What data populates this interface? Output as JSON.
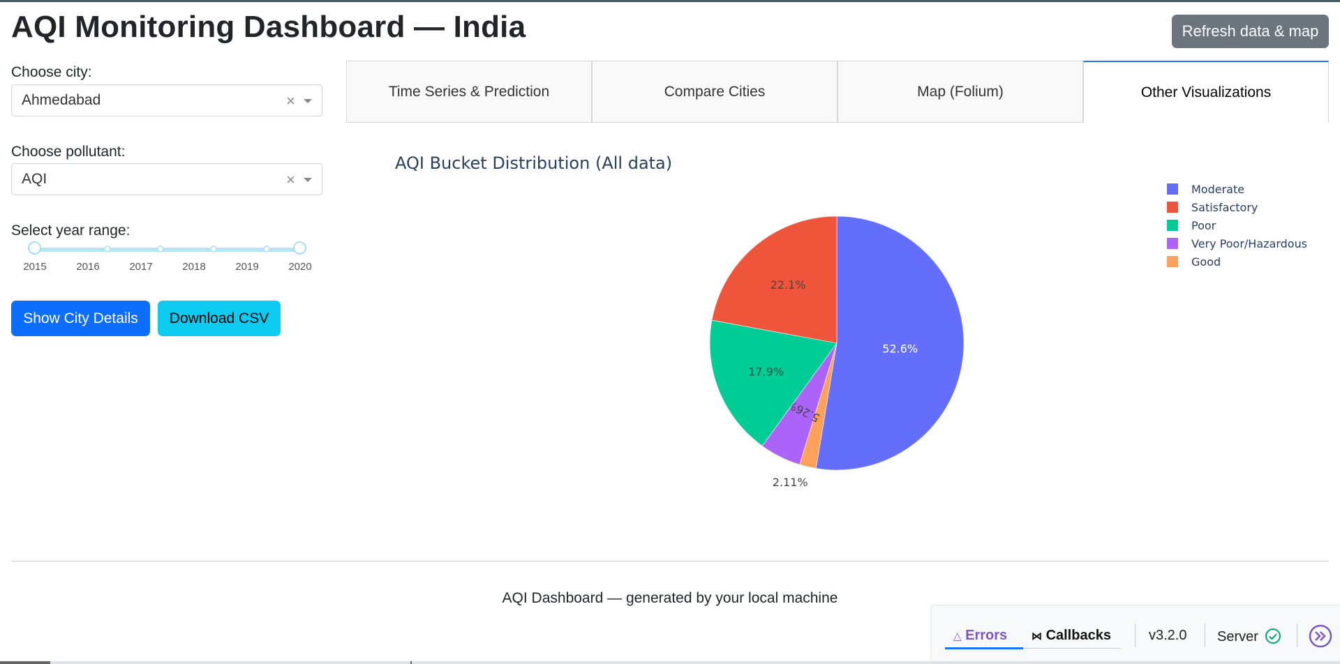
{
  "header": {
    "title": "AQI Monitoring Dashboard — India",
    "refresh_label": "Refresh data & map"
  },
  "controls": {
    "city_label": "Choose city:",
    "city_value": "Ahmedabad",
    "pollutant_label": "Choose pollutant:",
    "pollutant_value": "AQI",
    "year_label": "Select year range:",
    "year_ticks": [
      "2015",
      "2016",
      "2017",
      "2018",
      "2019",
      "2020"
    ],
    "year_range": [
      2015,
      2020
    ],
    "clear_glyph": "×",
    "show_details_label": "Show City Details",
    "download_label": "Download CSV"
  },
  "tabs": [
    {
      "label": "Time Series & Prediction",
      "active": false
    },
    {
      "label": "Compare Cities",
      "active": false
    },
    {
      "label": "Map (Folium)",
      "active": false
    },
    {
      "label": "Other Visualizations",
      "active": true
    }
  ],
  "chart_data": {
    "type": "pie",
    "title": "AQI Bucket Distribution (All data)",
    "labels": [
      "Moderate",
      "Satisfactory",
      "Poor",
      "Very Poor/Hazardous",
      "Good"
    ],
    "values": [
      52.6,
      22.1,
      17.9,
      5.26,
      2.11
    ],
    "value_labels": [
      "52.6%",
      "22.1%",
      "17.9%",
      "5.26%",
      "2.11%"
    ],
    "colors": [
      "#636efa",
      "#ef553b",
      "#00cc96",
      "#ab63fa",
      "#ffa15a"
    ],
    "legend_position": "top-right",
    "slice_order": [
      "Moderate",
      "Good",
      "Very Poor/Hazardous",
      "Poor",
      "Satisfactory"
    ]
  },
  "footer": {
    "text": "AQI Dashboard — generated by your local machine"
  },
  "devtools": {
    "errors_label": "Errors",
    "callbacks_label": "Callbacks",
    "version": "v3.2.0",
    "server_label": "Server"
  }
}
